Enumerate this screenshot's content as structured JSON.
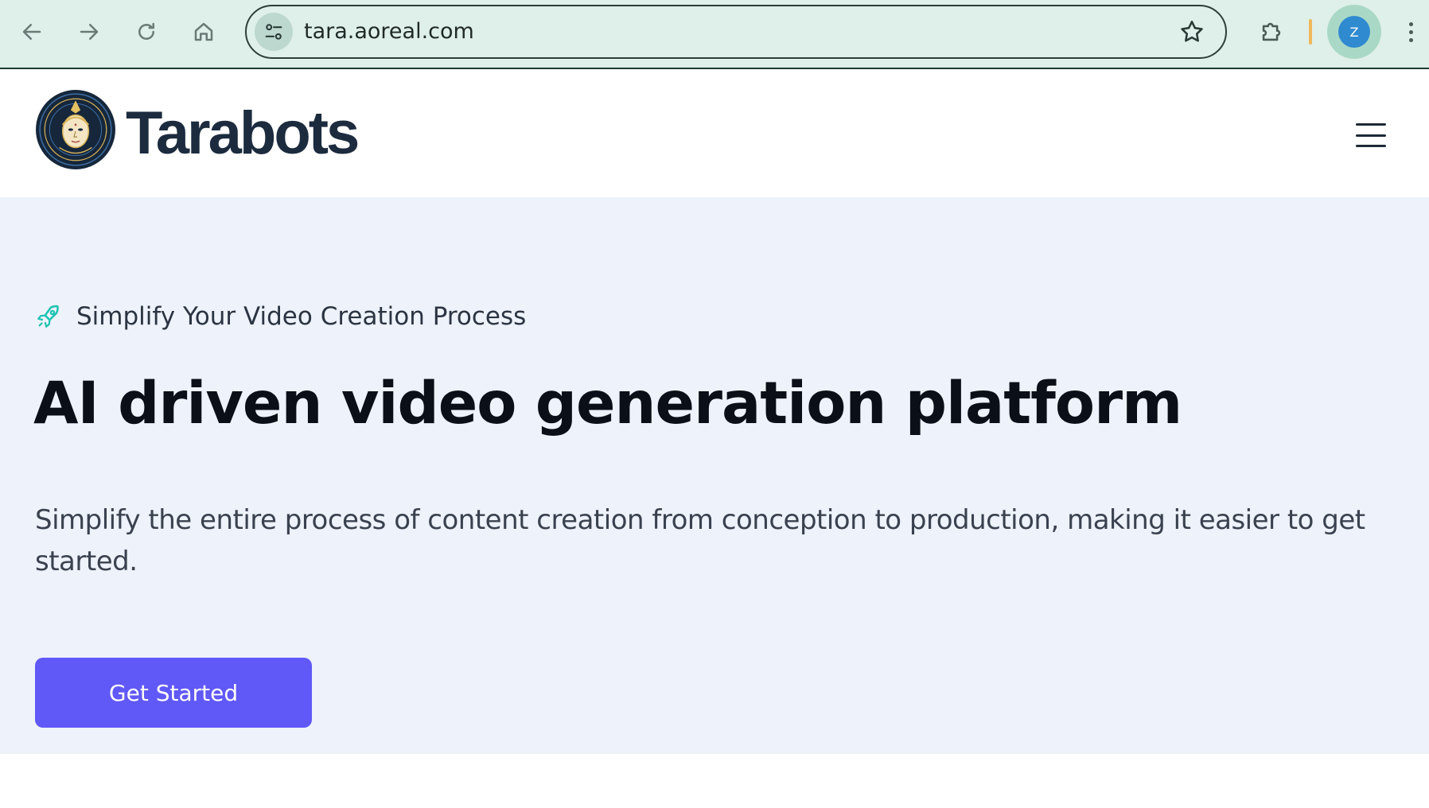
{
  "browser": {
    "url": "tara.aoreal.com",
    "profile_initial": "Z",
    "icons": {
      "back": "arrow-left-icon",
      "forward": "arrow-right-icon",
      "reload": "reload-icon",
      "home": "home-icon",
      "site_info": "tune-icon",
      "bookmark": "star-icon",
      "extensions": "puzzle-icon",
      "menu": "kebab-menu-icon"
    }
  },
  "header": {
    "brand_name": "Tarabots",
    "menu_icon": "hamburger-icon"
  },
  "hero": {
    "tagline_icon": "rocket-icon",
    "tagline": "Simplify Your Video Creation Process",
    "headline": "AI driven video generation platform",
    "subtitle": "Simplify the entire process of content creation from conception to production, making it easier to get started.",
    "cta_label": "Get Started"
  },
  "colors": {
    "chrome_bg": "#dfefe9",
    "hero_bg": "#eef2fa",
    "brand_text": "#1c2b3e",
    "cta_bg": "#6058f7",
    "rocket_accent": "#1fc3b4",
    "avatar_bg": "#2f8ad0"
  }
}
